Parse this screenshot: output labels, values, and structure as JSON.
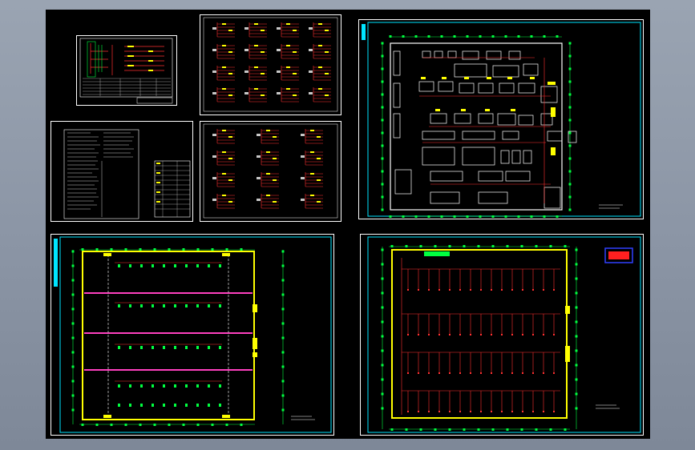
{
  "canvas": {
    "background": "#000000",
    "sheet_frame_colors": {
      "white": "#ffffff",
      "cyan": "#00e5ff"
    }
  },
  "drawing_colors": {
    "wire_red": "#ff3030",
    "pink_beam": "#ff40c0",
    "yellow": "#ffff00",
    "green": "#00ff40",
    "cyan": "#00e5ff",
    "grey_text": "#c8c8c8"
  },
  "sheets": [
    {
      "id": "system-diagram"
    },
    {
      "id": "distribution-box-schedules-1"
    },
    {
      "id": "design-notes"
    },
    {
      "id": "distribution-box-schedules-2"
    },
    {
      "id": "equipment-layout-plan"
    },
    {
      "id": "lighting-wiring-plan"
    },
    {
      "id": "power-grid-plan"
    }
  ]
}
